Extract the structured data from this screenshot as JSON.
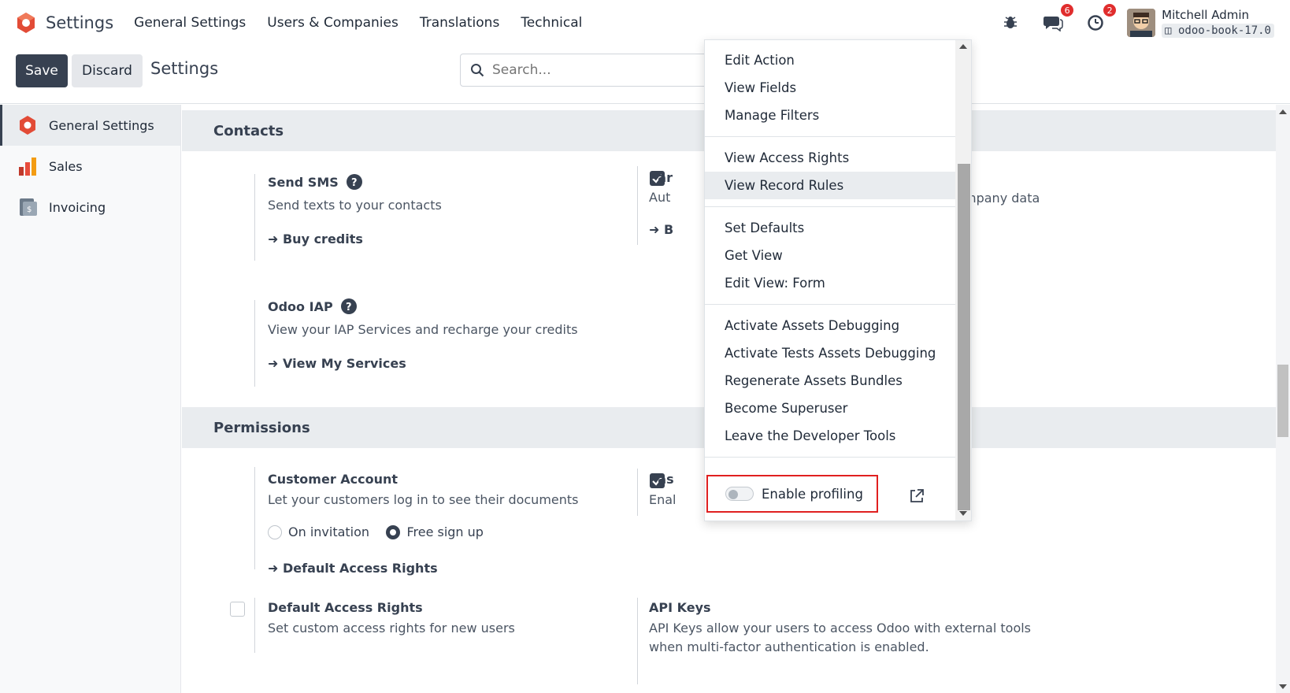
{
  "navbar": {
    "app_name": "Settings",
    "menu": [
      "General Settings",
      "Users & Companies",
      "Translations",
      "Technical"
    ],
    "messages_badge": "6",
    "activities_badge": "2",
    "user_name": "Mitchell Admin",
    "db_name": "odoo-book-17.0"
  },
  "control": {
    "save_label": "Save",
    "discard_label": "Discard",
    "breadcrumb": "Settings",
    "search_placeholder": "Search..."
  },
  "sidebar": {
    "items": [
      {
        "label": "General Settings"
      },
      {
        "label": "Sales"
      },
      {
        "label": "Invoicing"
      }
    ]
  },
  "contacts": {
    "heading": "Contacts",
    "send_sms": {
      "title": "Send SMS",
      "desc": "Send texts to your contacts",
      "link": "Buy credits"
    },
    "partner": {
      "title": "Par",
      "desc": "Aut",
      "link": "B",
      "trailing": "mpany data"
    },
    "iap": {
      "title": "Odoo IAP",
      "desc": "View your IAP Services and recharge your credits",
      "link": "View My Services"
    }
  },
  "permissions": {
    "heading": "Permissions",
    "customer_account": {
      "title": "Customer Account",
      "desc": "Let your customers log in to see their documents",
      "options": [
        "On invitation",
        "Free sign up"
      ],
      "selected": "Free sign up",
      "link": "Default Access Rights"
    },
    "password": {
      "title": "Pas",
      "desc": "Enal"
    },
    "default_access": {
      "title": "Default Access Rights",
      "desc": "Set custom access rights for new users"
    },
    "api_keys": {
      "title": "API Keys",
      "desc_line1": "API Keys allow your users to access Odoo with external tools",
      "desc_line2": "when multi-factor authentication is enabled."
    }
  },
  "debug_menu": {
    "groups": [
      [
        "Edit Action",
        "View Fields",
        "Manage Filters"
      ],
      [
        "View Access Rights",
        "View Record Rules"
      ],
      [
        "Set Defaults",
        "Get View",
        "Edit View: Form"
      ],
      [
        "Activate Assets Debugging",
        "Activate Tests Assets Debugging",
        "Regenerate Assets Bundles",
        "Become Superuser",
        "Leave the Developer Tools"
      ]
    ],
    "hovered": "View Record Rules",
    "profiling_label": "Enable profiling",
    "profiling_enabled": false
  },
  "colors": {
    "primary": "#374151",
    "badge": "#e02d2d",
    "highlight_box": "#e02020",
    "logo": "#e24b36"
  }
}
